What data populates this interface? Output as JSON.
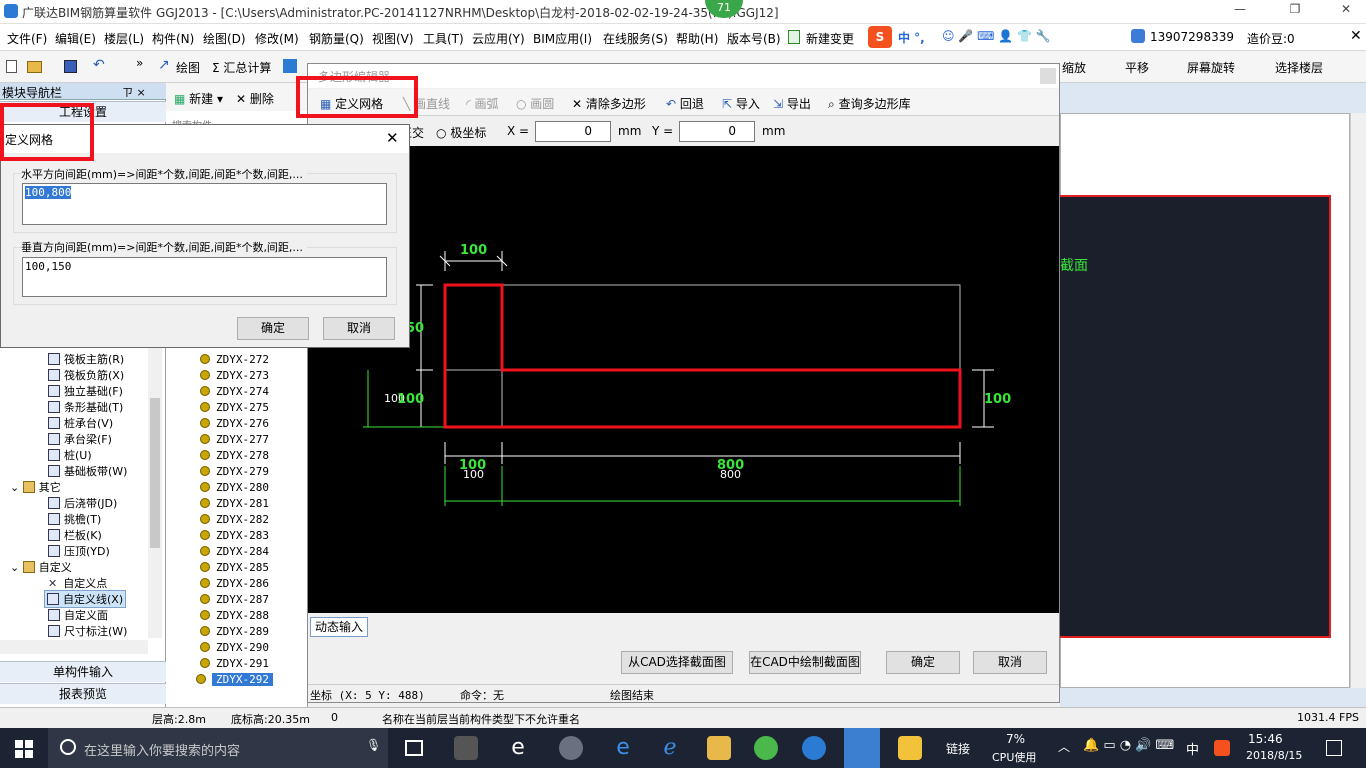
{
  "window": {
    "title": "广联达BIM钢筋算量软件 GGJ2013 - [C:\\Users\\Administrator.PC-20141127NRHM\\Desktop\\白龙村-2018-02-02-19-24-35(... ).GGJ12]",
    "badge": "71"
  },
  "menu": {
    "items": [
      "文件(F)",
      "编辑(E)",
      "楼层(L)",
      "构件(N)",
      "绘图(D)",
      "修改(M)",
      "钢筋量(Q)",
      "视图(V)",
      "工具(T)",
      "云应用(Y)",
      "BIM应用(I)",
      "在线服务(S)",
      "帮助(H)",
      "版本号(B)",
      "新建变更"
    ],
    "phone": "13907298339",
    "price_label": "造价豆:0"
  },
  "toolbar": {
    "draw": "绘图",
    "sum": "Σ 汇总计算",
    "zoom": "缩放",
    "pan": "平移",
    "rotate": "屏幕旋转",
    "select_floor": "选择楼层"
  },
  "leftnav": {
    "title": "模块导航栏",
    "pin": "ㄗ ×",
    "section": "工程设置",
    "items": [
      "筏板主筋(R)",
      "筏板负筋(X)",
      "独立基础(F)",
      "条形基础(T)",
      "桩承台(V)",
      "承台梁(F)",
      "桩(U)",
      "基础板带(W)"
    ],
    "group_other": "其它",
    "other_items": [
      "后浇带(JD)",
      "挑檐(T)",
      "栏板(K)",
      "压顶(YD)"
    ],
    "group_custom": "自定义",
    "custom_items": [
      "自定义点",
      "自定义线(X)",
      "自定义面",
      "尺寸标注(W)"
    ],
    "btn_single": "单构件输入",
    "btn_report": "报表预览"
  },
  "complist": {
    "new": "新建",
    "delete": "删除",
    "header": "搜索构件...",
    "items": [
      "ZDYX-272",
      "ZDYX-273",
      "ZDYX-274",
      "ZDYX-275",
      "ZDYX-276",
      "ZDYX-277",
      "ZDYX-278",
      "ZDYX-279",
      "ZDYX-280",
      "ZDYX-281",
      "ZDYX-282",
      "ZDYX-283",
      "ZDYX-284",
      "ZDYX-285",
      "ZDYX-286",
      "ZDYX-287",
      "ZDYX-288",
      "ZDYX-289",
      "ZDYX-290",
      "ZDYX-291",
      "ZDYX-292"
    ]
  },
  "editor": {
    "title": "多边形编辑器",
    "define_grid": "定义网格",
    "line": "画直线",
    "arc": "画弧",
    "circle": "画圆",
    "clear": "清除多边形",
    "undo": "回退",
    "import": "导入",
    "export": "导出",
    "query": "查询多边形库",
    "ortho": "正交",
    "polar": "极坐标",
    "x_label": "X =",
    "y_label": "Y =",
    "x_val": "0",
    "y_val": "0",
    "unit": "mm",
    "dyn": "动态输入",
    "from_cad": "从CAD选择截面图",
    "draw_cad": "在CAD中绘制截面图",
    "ok": "确定",
    "cancel": "取消",
    "coord": "坐标 (X: 5 Y: 488)",
    "cmd": "命令：无",
    "draw_end": "绘图结束",
    "dims": {
      "top": "100",
      "left1": "50",
      "left2": "100",
      "left2b": "100",
      "right": "100",
      "bottom1": "100",
      "bottom1b": "100",
      "bottom2": "800",
      "bottom2b": "800"
    },
    "right_label": "截面"
  },
  "griddlg": {
    "title": "定义网格",
    "h_label": "水平方向间距(mm)=>间距*个数,间距,间距*个数,间距,...",
    "h_value": "100,800",
    "v_label": "垂直方向间距(mm)=>间距*个数,间距,间距*个数,间距,...",
    "v_value": "100,150",
    "ok": "确定",
    "cancel": "取消"
  },
  "status": {
    "floor_h": "层高:2.8m",
    "base_h": "底标高:20.35m",
    "zero": "0",
    "msg": "名称在当前层当前构件类型下不允许重名",
    "fps": "1031.4 FPS"
  },
  "taskbar": {
    "search": "在这里输入你要搜索的内容",
    "link": "链接",
    "cpu": "7%",
    "cpu_label": "CPU使用",
    "ime": "中",
    "time": "15:46",
    "date": "2018/8/15"
  },
  "colors": {
    "accent_red": "#f0131e",
    "canvas": "#000000",
    "dim_green": "#39e639"
  }
}
